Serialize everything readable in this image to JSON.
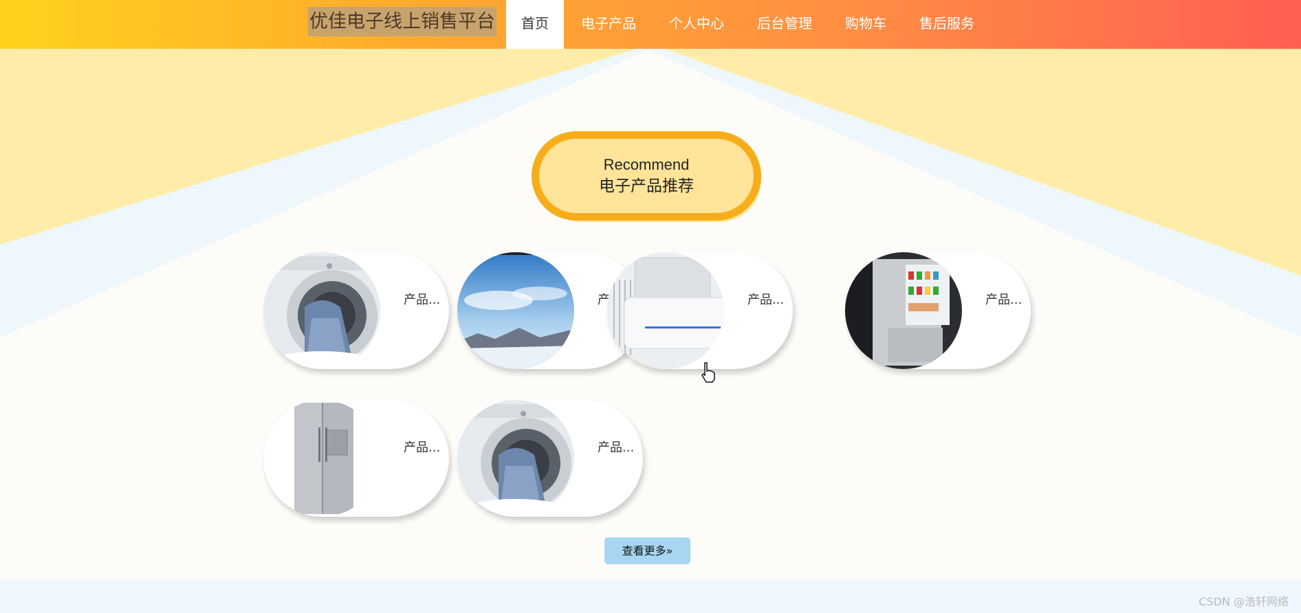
{
  "header": {
    "brand": "优佳电子线上销售平台",
    "nav": [
      {
        "label": "首页",
        "active": true
      },
      {
        "label": "电子产品",
        "active": false
      },
      {
        "label": "个人中心",
        "active": false
      },
      {
        "label": "后台管理",
        "active": false
      },
      {
        "label": "购物车",
        "active": false
      },
      {
        "label": "售后服务",
        "active": false
      }
    ]
  },
  "section": {
    "title_en": "Recommend",
    "title_cn": "电子产品推荐"
  },
  "products": [
    {
      "label": "产品...",
      "image": "washing-machine"
    },
    {
      "label": "产品...",
      "image": "sky-landscape"
    },
    {
      "label": "产品...",
      "image": "air-conditioner"
    },
    {
      "label": "产品...",
      "image": "refrigerator-open"
    },
    {
      "label": "产品...",
      "image": "refrigerator"
    },
    {
      "label": "产品...",
      "image": "washing-machine"
    }
  ],
  "more_button": "查看更多»",
  "watermark": "CSDN @浩轩网络",
  "colors": {
    "accent": "#f7ad1a",
    "pill_fill": "#ffe49a",
    "button": "#a6d6f2"
  }
}
